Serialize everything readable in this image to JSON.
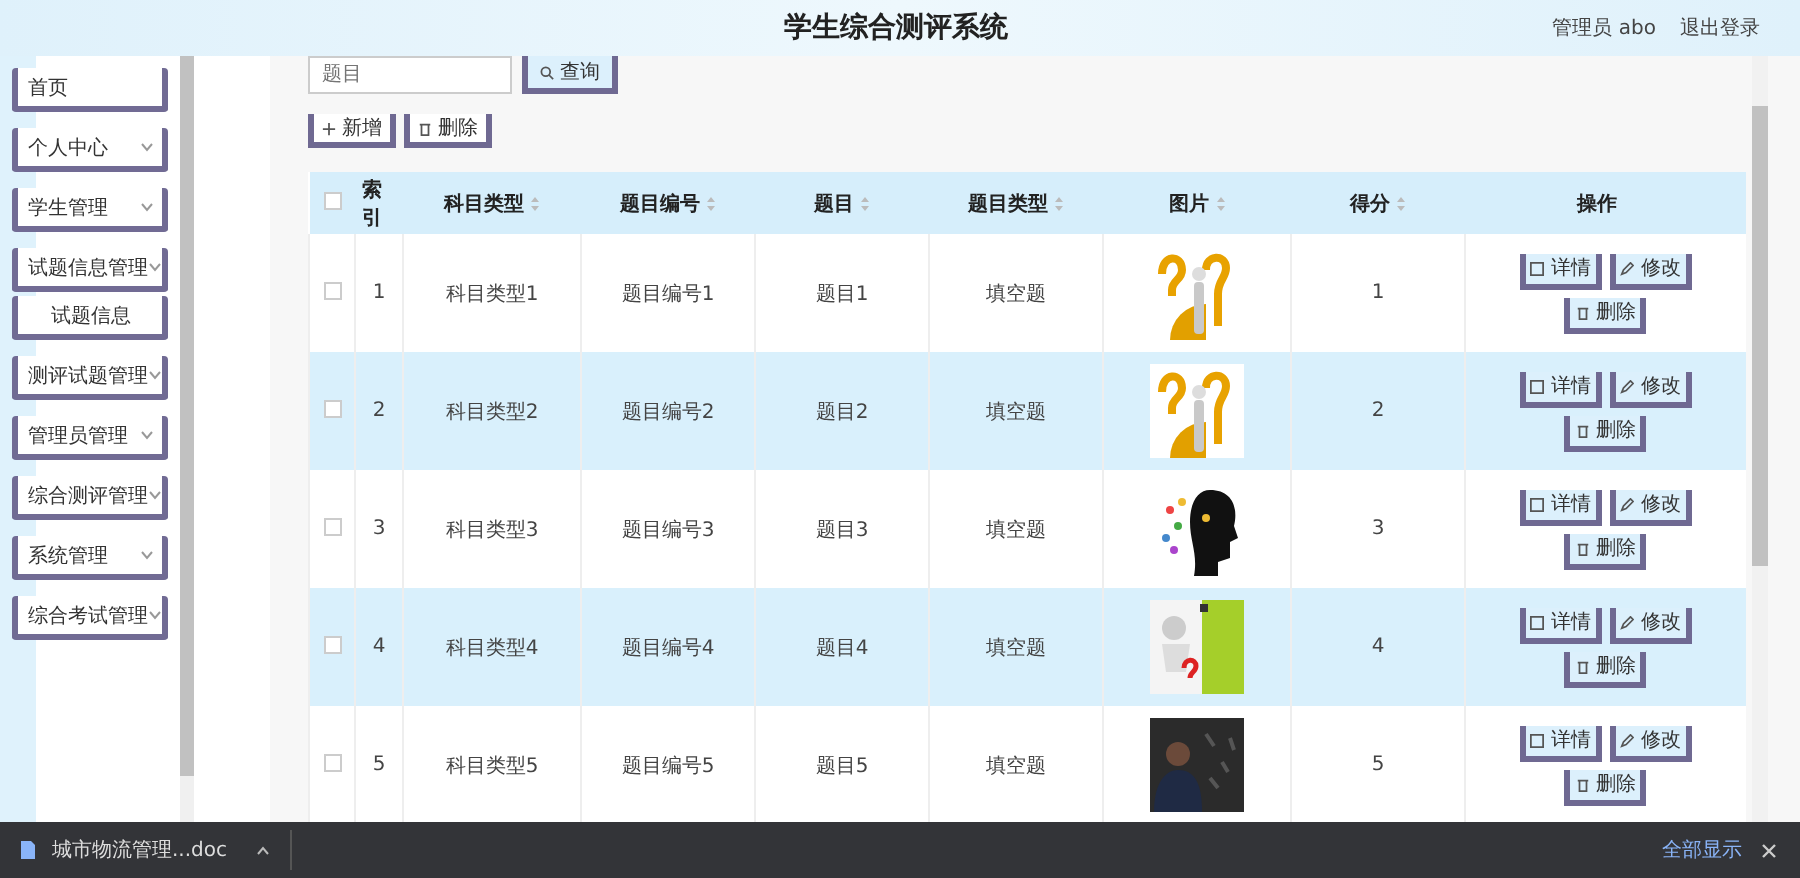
{
  "header": {
    "title": "学生综合测评系统",
    "user": "管理员 abo",
    "logout": "退出登录"
  },
  "sidebar": {
    "items": [
      {
        "label": "首页",
        "kind": "link"
      },
      {
        "label": "个人中心",
        "kind": "menu"
      },
      {
        "label": "学生管理",
        "kind": "menu"
      },
      {
        "label": "试题信息管理",
        "kind": "menu",
        "children": [
          {
            "label": "试题信息",
            "kind": "link"
          }
        ]
      },
      {
        "label": "测评试题管理",
        "kind": "menu"
      },
      {
        "label": "管理员管理",
        "kind": "menu"
      },
      {
        "label": "综合测评管理",
        "kind": "menu"
      },
      {
        "label": "系统管理",
        "kind": "menu"
      },
      {
        "label": "综合考试管理",
        "kind": "menu"
      }
    ]
  },
  "search": {
    "placeholder": "题目",
    "button": "查询"
  },
  "actions": [
    {
      "label": "新增",
      "kind": "add"
    },
    {
      "label": "删除",
      "kind": "delete"
    }
  ],
  "table": {
    "select_all": {
      "checked": false
    },
    "columns": [
      {
        "label": "索引",
        "sortable": false
      },
      {
        "label": "科目类型",
        "sortable": true
      },
      {
        "label": "题目编号",
        "sortable": true
      },
      {
        "label": "题目",
        "sortable": true
      },
      {
        "label": "题目类型",
        "sortable": true
      },
      {
        "label": "图片",
        "sortable": true
      },
      {
        "label": "得分",
        "sortable": true
      },
      {
        "label": "操作",
        "sortable": false
      }
    ],
    "rows": [
      {
        "checked": false,
        "cells": [
          "1",
          "科目类型1",
          "题目编号1",
          "题目1",
          "填空题"
        ],
        "score": "1",
        "buttons": [
          {
            "label": "详情",
            "kind": "detail"
          },
          {
            "label": "修改",
            "kind": "edit"
          },
          {
            "label": "删除",
            "kind": "delete"
          }
        ]
      },
      {
        "checked": false,
        "cells": [
          "2",
          "科目类型2",
          "题目编号2",
          "题目2",
          "填空题"
        ],
        "score": "2",
        "buttons": [
          {
            "label": "详情",
            "kind": "detail"
          },
          {
            "label": "修改",
            "kind": "edit"
          },
          {
            "label": "删除",
            "kind": "delete"
          }
        ]
      },
      {
        "checked": false,
        "cells": [
          "3",
          "科目类型3",
          "题目编号3",
          "题目3",
          "填空题"
        ],
        "score": "3",
        "buttons": [
          {
            "label": "详情",
            "kind": "detail"
          },
          {
            "label": "修改",
            "kind": "edit"
          },
          {
            "label": "删除",
            "kind": "delete"
          }
        ]
      },
      {
        "checked": false,
        "cells": [
          "4",
          "科目类型4",
          "题目编号4",
          "题目4",
          "填空题"
        ],
        "score": "4",
        "buttons": [
          {
            "label": "详情",
            "kind": "detail"
          },
          {
            "label": "修改",
            "kind": "edit"
          },
          {
            "label": "删除",
            "kind": "delete"
          }
        ]
      },
      {
        "checked": false,
        "cells": [
          "5",
          "科目类型5",
          "题目编号5",
          "题目5",
          "填空题"
        ],
        "score": "5",
        "buttons": [
          {
            "label": "详情",
            "kind": "detail"
          },
          {
            "label": "修改",
            "kind": "edit"
          },
          {
            "label": "删除",
            "kind": "delete"
          }
        ]
      }
    ]
  },
  "download_bar": {
    "file": "城市物流管理...doc",
    "show_all": "全部显示"
  }
}
